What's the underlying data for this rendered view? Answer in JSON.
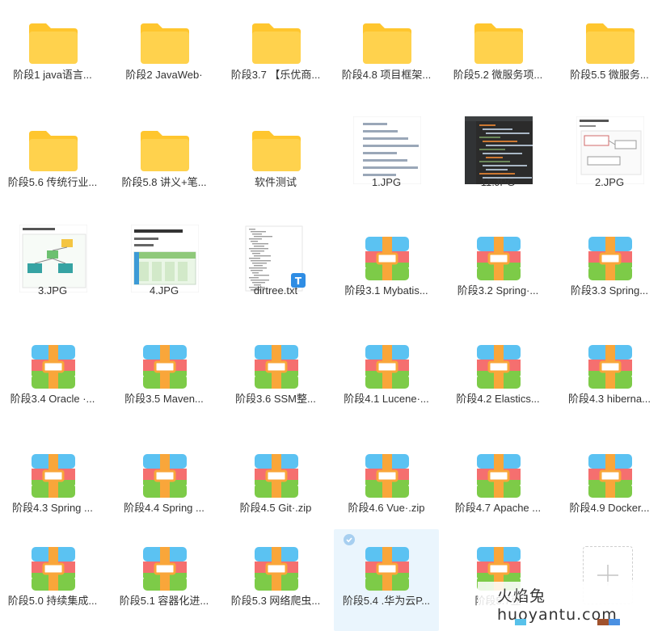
{
  "colors": {
    "folder": "#ffd24d",
    "folder_tab": "#ffc62e",
    "archive_top": "#5bc2f2",
    "archive_middle": "#f56f6f",
    "archive_bottom": "#7dcb48",
    "archive_strap": "#f9a63a",
    "selected_bg": "#eaf5fd",
    "text": "#333333"
  },
  "items": [
    {
      "label": "阶段1 java语言...",
      "icon": "folder-icon",
      "selected": false
    },
    {
      "label": "阶段2 JavaWeb·",
      "icon": "folder-icon",
      "selected": false
    },
    {
      "label": "阶段3.7 【乐优商...",
      "icon": "folder-icon",
      "selected": false
    },
    {
      "label": "阶段4.8 项目框架...",
      "icon": "folder-icon",
      "selected": false
    },
    {
      "label": "阶段5.2 微服务项...",
      "icon": "folder-icon",
      "selected": false
    },
    {
      "label": "阶段5.5  微服务...",
      "icon": "folder-icon",
      "selected": false
    },
    {
      "label": "阶段5.6 传统行业...",
      "icon": "folder-icon",
      "selected": false
    },
    {
      "label": "阶段5.8 讲义+笔...",
      "icon": "folder-icon",
      "selected": false
    },
    {
      "label": "软件测试",
      "icon": "folder-icon",
      "selected": false
    },
    {
      "label": "1.JPG",
      "icon": "image-thumb-text",
      "selected": false
    },
    {
      "label": "11.JPG",
      "icon": "image-thumb-code",
      "selected": false
    },
    {
      "label": "2.JPG",
      "icon": "image-thumb-doc",
      "selected": false
    },
    {
      "label": "3.JPG",
      "icon": "image-thumb-diagram",
      "selected": false
    },
    {
      "label": "4.JPG",
      "icon": "image-thumb-doc-table",
      "selected": false
    },
    {
      "label": "dirtree.txt",
      "icon": "text-file-icon",
      "selected": false
    },
    {
      "label": "阶段3.1 Mybatis...",
      "icon": "archive-icon",
      "selected": false
    },
    {
      "label": "阶段3.2 Spring·...",
      "icon": "archive-icon",
      "selected": false
    },
    {
      "label": "阶段3.3 Spring...",
      "icon": "archive-icon",
      "selected": false
    },
    {
      "label": "阶段3.4 Oracle ·...",
      "icon": "archive-icon",
      "selected": false
    },
    {
      "label": "阶段3.5 Maven...",
      "icon": "archive-icon",
      "selected": false
    },
    {
      "label": "阶段3.6 SSM整...",
      "icon": "archive-icon",
      "selected": false
    },
    {
      "label": "阶段4.1 Lucene·...",
      "icon": "archive-icon",
      "selected": false
    },
    {
      "label": "阶段4.2 Elastics...",
      "icon": "archive-icon",
      "selected": false
    },
    {
      "label": "阶段4.3 hiberna...",
      "icon": "archive-icon",
      "selected": false
    },
    {
      "label": "阶段4.3 Spring ...",
      "icon": "archive-icon",
      "selected": false
    },
    {
      "label": "阶段4.4 Spring ...",
      "icon": "archive-icon",
      "selected": false
    },
    {
      "label": "阶段4.5 Git·.zip",
      "icon": "archive-icon",
      "selected": false
    },
    {
      "label": "阶段4.6 Vue·.zip",
      "icon": "archive-icon",
      "selected": false
    },
    {
      "label": "阶段4.7 Apache ...",
      "icon": "archive-icon",
      "selected": false
    },
    {
      "label": "阶段4.9 Docker...",
      "icon": "archive-icon",
      "selected": false
    },
    {
      "label": "阶段5.0 持续集成...",
      "icon": "archive-icon",
      "selected": false
    },
    {
      "label": "阶段5.1 容器化进...",
      "icon": "archive-icon",
      "selected": false
    },
    {
      "label": "阶段5.3 网络爬虫...",
      "icon": "archive-icon",
      "selected": false
    },
    {
      "label": "阶段5.4 .华为云P...",
      "icon": "archive-icon",
      "selected": true
    },
    {
      "label": "阶段5.7豆",
      "icon": "archive-icon",
      "selected": false
    }
  ],
  "watermark": {
    "text": "火焰兔 huoyantu.com"
  }
}
